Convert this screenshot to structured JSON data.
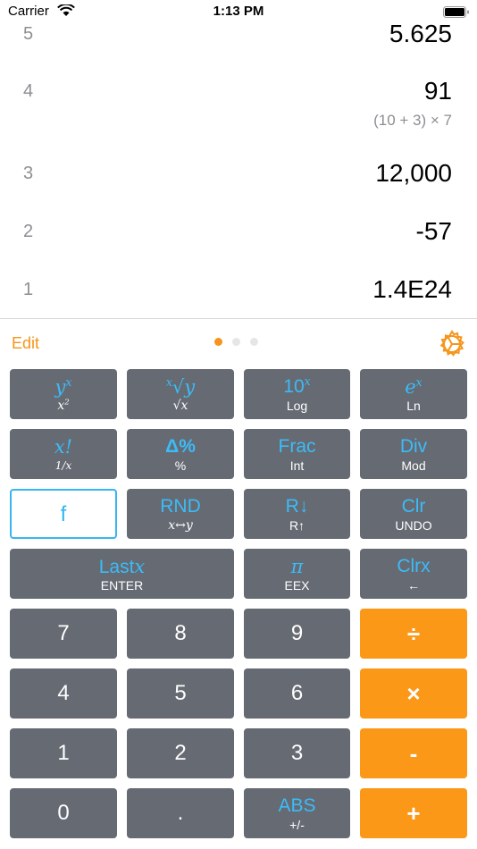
{
  "status_bar": {
    "carrier": "Carrier",
    "time": "1:13 PM"
  },
  "stack": [
    {
      "index": "5",
      "value": "5.625",
      "expression": ""
    },
    {
      "index": "4",
      "value": "91",
      "expression": "(10 + 3) × 7"
    },
    {
      "index": "3",
      "value": "12,000",
      "expression": ""
    },
    {
      "index": "2",
      "value": "-57",
      "expression": ""
    },
    {
      "index": "1",
      "value": "1.4E24",
      "expression": ""
    }
  ],
  "toolbar": {
    "edit_label": "Edit",
    "page_count": 3,
    "active_page": 1
  },
  "keys": {
    "yx": {
      "main": "y",
      "main_sup": "x",
      "sub": "x",
      "sub_sup": "2"
    },
    "root": {
      "main": "√y",
      "main_sup": "x",
      "sub": "√x"
    },
    "ten_x": {
      "main": "10",
      "main_sup": "x",
      "sub": "Log"
    },
    "e_x": {
      "main": "e",
      "main_sup": "x",
      "sub": "Ln"
    },
    "fact": {
      "main": "x!",
      "sub": "1/x"
    },
    "delta_pct": {
      "main": "Δ%",
      "sub": "%"
    },
    "frac": {
      "main": "Frac",
      "sub": "Int"
    },
    "div": {
      "main": "Div",
      "sub": "Mod"
    },
    "f": {
      "main": "f"
    },
    "rnd": {
      "main": "RND",
      "sub": "x↔y"
    },
    "roll": {
      "main": "R↓",
      "sub": "R↑"
    },
    "clr": {
      "main": "Clr",
      "sub": "UNDO"
    },
    "lastx": {
      "main": "Last",
      "main_var": "x",
      "sub": "ENTER"
    },
    "pi": {
      "main": "π",
      "sub": "EEX"
    },
    "clrx": {
      "main": "Clrx",
      "sub": "←"
    },
    "n7": "7",
    "n8": "8",
    "n9": "9",
    "divide": "÷",
    "n4": "4",
    "n5": "5",
    "n6": "6",
    "multiply": "×",
    "n1": "1",
    "n2": "2",
    "n3": "3",
    "minus": "-",
    "n0": "0",
    "dot": ".",
    "abs": {
      "main": "ABS",
      "sub": "+/-"
    },
    "plus": "+"
  },
  "colors": {
    "accent_orange": "#f5951b",
    "key_gray": "#666a73",
    "label_blue": "#3bbcf8",
    "f_border": "#35b6f0"
  },
  "icons": {
    "wifi": "wifi-icon",
    "battery": "battery-icon",
    "settings": "gear-icon"
  }
}
